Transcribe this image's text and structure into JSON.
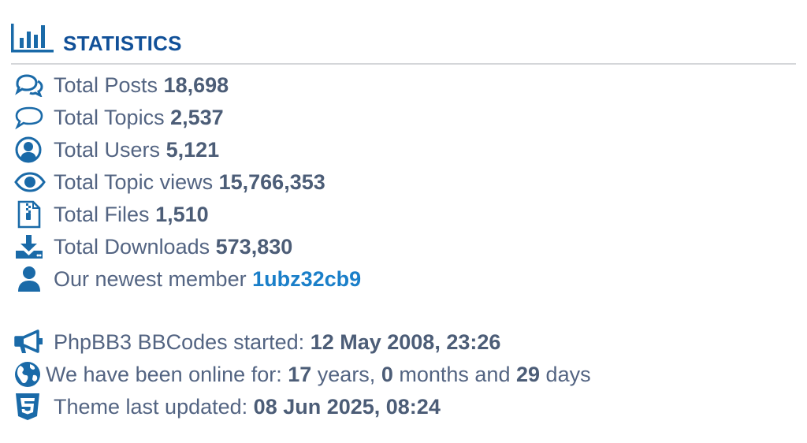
{
  "header": {
    "title": "STATISTICS",
    "icon": "bar-chart-icon"
  },
  "colors": {
    "accent": "#115098",
    "text": "#536482",
    "icon": "#1a6aa8",
    "link": "#1a7fc9",
    "rule": "#d4d6d9"
  },
  "stats": [
    {
      "icon": "comments-icon",
      "label": "Total Posts",
      "value": "18,698"
    },
    {
      "icon": "comment-icon",
      "label": "Total Topics",
      "value": "2,537"
    },
    {
      "icon": "user-circle-icon",
      "label": "Total Users",
      "value": "5,121"
    },
    {
      "icon": "eye-icon",
      "label": "Total Topic views",
      "value": "15,766,353"
    },
    {
      "icon": "file-zip-icon",
      "label": "Total Files",
      "value": "1,510"
    },
    {
      "icon": "download-icon",
      "label": "Total Downloads",
      "value": "573,830"
    },
    {
      "icon": "user-icon",
      "label": "Our newest member",
      "value": "1ubz32cb9"
    }
  ],
  "info": {
    "started": {
      "icon": "bullhorn-icon",
      "label": "PhpBB3 BBCodes started:",
      "value": "12 May 2008, 23:26"
    },
    "online": {
      "icon": "globe-icon",
      "label": "We have been online for:",
      "years": "17",
      "years_word": "years,",
      "months": "0",
      "months_word": "months and",
      "days": "29",
      "days_word": "days"
    },
    "theme": {
      "icon": "css3-icon",
      "label": "Theme last updated:",
      "value": "08 Jun 2025, 08:24"
    }
  }
}
